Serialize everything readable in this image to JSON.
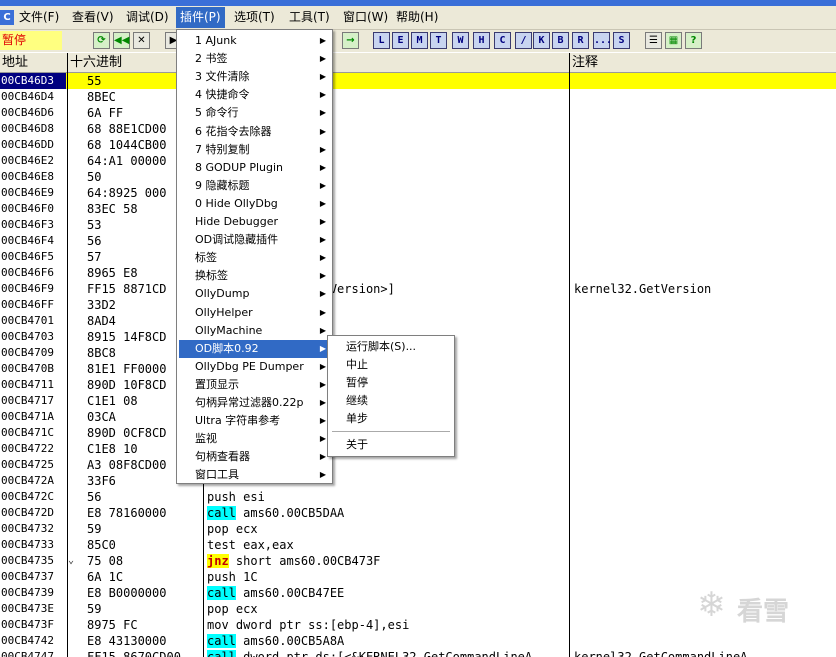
{
  "menubar": {
    "sys": "C",
    "items": [
      "文件(F)",
      "查看(V)",
      "调试(D)",
      "插件(P)",
      "选项(T)",
      "工具(T)",
      "窗口(W)",
      "帮助(H)"
    ]
  },
  "toolbar": {
    "status": "暂停",
    "letters": [
      "L",
      "E",
      "M",
      "T",
      "W",
      "H",
      "C",
      "/",
      "K",
      "B",
      "R",
      "...",
      "S"
    ]
  },
  "columns": {
    "addr": "地址",
    "hex": "十六进制",
    "disasm": "",
    "comment": "注释"
  },
  "rows": [
    {
      "addr": "00CB46D3",
      "hex": "55",
      "dis": "",
      "cmt": ""
    },
    {
      "addr": "00CB46D4",
      "hex": "8BEC",
      "dis": "",
      "cmt": ""
    },
    {
      "addr": "00CB46D6",
      "hex": "6A FF",
      "dis": "",
      "cmt": ""
    },
    {
      "addr": "00CB46D8",
      "hex": "68 88E1CD00",
      "dis": "188",
      "cmt": ""
    },
    {
      "addr": "00CB46DD",
      "hex": "68 1044CB00",
      "dis": "410",
      "cmt": ""
    },
    {
      "addr": "00CB46E2",
      "hex": "64:A1 00000",
      "dis": "r fs:[0]",
      "cmt": ""
    },
    {
      "addr": "00CB46E8",
      "hex": "50",
      "dis": "",
      "cmt": ""
    },
    {
      "addr": "00CB46E9",
      "hex": "64:8925 000",
      "dis": ":[0],esp",
      "cmt": ""
    },
    {
      "addr": "00CB46F0",
      "hex": "83EC 58",
      "dis": "",
      "cmt": ""
    },
    {
      "addr": "00CB46F3",
      "hex": "53",
      "dis": "",
      "cmt": ""
    },
    {
      "addr": "00CB46F4",
      "hex": "56",
      "dis": "",
      "cmt": ""
    },
    {
      "addr": "00CB46F5",
      "hex": "57",
      "dis": "",
      "cmt": ""
    },
    {
      "addr": "00CB46F6",
      "hex": "8965 E8",
      "dis": "s:[ebp-18],esp",
      "cmt": ""
    },
    {
      "addr": "00CB46F9",
      "hex": "FF15 8871CD",
      "dis": "s:[<&KERNEL32.GetVersion>]",
      "cmt": "kernel32.GetVersion"
    },
    {
      "addr": "00CB46FF",
      "hex": "33D2",
      "dis": "",
      "cmt": ""
    },
    {
      "addr": "00CB4701",
      "hex": "8AD4",
      "dis": "",
      "cmt": ""
    },
    {
      "addr": "00CB4703",
      "hex": "8915 14F8CD",
      "dis": "",
      "cmt": ""
    },
    {
      "addr": "00CB4709",
      "hex": "8BC8",
      "dis": "",
      "cmt": ""
    },
    {
      "addr": "00CB470B",
      "hex": "81E1 FF0000",
      "dis": "",
      "cmt": ""
    },
    {
      "addr": "00CB4711",
      "hex": "890D 10F8CD",
      "dis": "",
      "cmt": ""
    },
    {
      "addr": "00CB4717",
      "hex": "C1E1 08",
      "dis": "",
      "cmt": ""
    },
    {
      "addr": "00CB471A",
      "hex": "03CA",
      "dis": "",
      "cmt": ""
    },
    {
      "addr": "00CB471C",
      "hex": "890D 0CF8CD",
      "dis": "",
      "cmt": ""
    },
    {
      "addr": "00CB4722",
      "hex": "C1E8 10",
      "dis": "",
      "cmt": ""
    },
    {
      "addr": "00CB4725",
      "hex": "A3 08F8CD00",
      "dis": ":[CDF808],eax",
      "cmt": ""
    },
    {
      "addr": "00CB472A",
      "hex": "33F6",
      "dis": "",
      "cmt": ""
    },
    {
      "addr": "00CB472C",
      "hex": "56",
      "dis": "push esi",
      "cmt": ""
    },
    {
      "addr": "00CB472D",
      "hex": "E8 78160000",
      "kw": "call",
      "dis": " ams60.00CB5DAA",
      "cmt": ""
    },
    {
      "addr": "00CB4732",
      "hex": "59",
      "dis": "pop ecx",
      "cmt": ""
    },
    {
      "addr": "00CB4733",
      "hex": "85C0",
      "dis": "test eax,eax",
      "cmt": ""
    },
    {
      "addr": "00CB4735",
      "hex": "75 08",
      "kwj": "jnz",
      "dis": " short ams60.00CB473F",
      "cmt": ""
    },
    {
      "addr": "00CB4737",
      "hex": "6A 1C",
      "dis": "push 1C",
      "cmt": ""
    },
    {
      "addr": "00CB4739",
      "hex": "E8 B0000000",
      "kw": "call",
      "dis": " ams60.00CB47EE",
      "cmt": ""
    },
    {
      "addr": "00CB473E",
      "hex": "59",
      "dis": "pop ecx",
      "cmt": ""
    },
    {
      "addr": "00CB473F",
      "hex": "8975 FC",
      "dis": "mov dword ptr ss:[ebp-4],esi",
      "cmt": ""
    },
    {
      "addr": "00CB4742",
      "hex": "E8 43130000",
      "kw": "call",
      "dis": " ams60.00CB5A8A",
      "cmt": ""
    },
    {
      "addr": "00CB4747",
      "hex": "FF15 8670CD00",
      "kw": "call",
      "dis": " dword ptr ds:[<&KERNEL32.GetCommandLineA",
      "cmt": "kernel32.GetCommandLineA"
    }
  ],
  "plugin_menu": [
    {
      "label": "1 AJunk",
      "arrow": true
    },
    {
      "label": "2 书签",
      "arrow": true
    },
    {
      "label": "3 文件清除",
      "arrow": true
    },
    {
      "label": "4 快捷命令",
      "arrow": true
    },
    {
      "label": "5 命令行",
      "arrow": true
    },
    {
      "label": "6 花指令去除器",
      "arrow": true
    },
    {
      "label": "7 特别复制",
      "arrow": true
    },
    {
      "label": "8 GODUP Plugin",
      "arrow": true
    },
    {
      "label": "9 隐藏标题",
      "arrow": true
    },
    {
      "label": "0 Hide OllyDbg",
      "arrow": true
    },
    {
      "label": "Hide Debugger",
      "arrow": true
    },
    {
      "label": "OD调试隐藏插件",
      "arrow": true
    },
    {
      "label": "标签",
      "arrow": true
    },
    {
      "label": "换标签",
      "arrow": true
    },
    {
      "label": "OllyDump",
      "arrow": true
    },
    {
      "label": "OllyHelper",
      "arrow": true
    },
    {
      "label": "OllyMachine",
      "arrow": true
    },
    {
      "label": "OD脚本0.92",
      "arrow": true,
      "hl": true
    },
    {
      "label": "OllyDbg PE Dumper",
      "arrow": true
    },
    {
      "label": "置顶显示",
      "arrow": true
    },
    {
      "label": "句柄异常过滤器0.22p",
      "arrow": true
    },
    {
      "label": "Ultra 字符串参考",
      "arrow": true
    },
    {
      "label": "监视",
      "arrow": true
    },
    {
      "label": "句柄查看器",
      "arrow": true
    },
    {
      "label": "窗口工具",
      "arrow": true
    }
  ],
  "script_menu": [
    "运行脚本(S)...",
    "中止",
    "暂停",
    "继续",
    "单步",
    "关于"
  ],
  "watermark": {
    "symbol": "❄",
    "text": "看雪"
  }
}
